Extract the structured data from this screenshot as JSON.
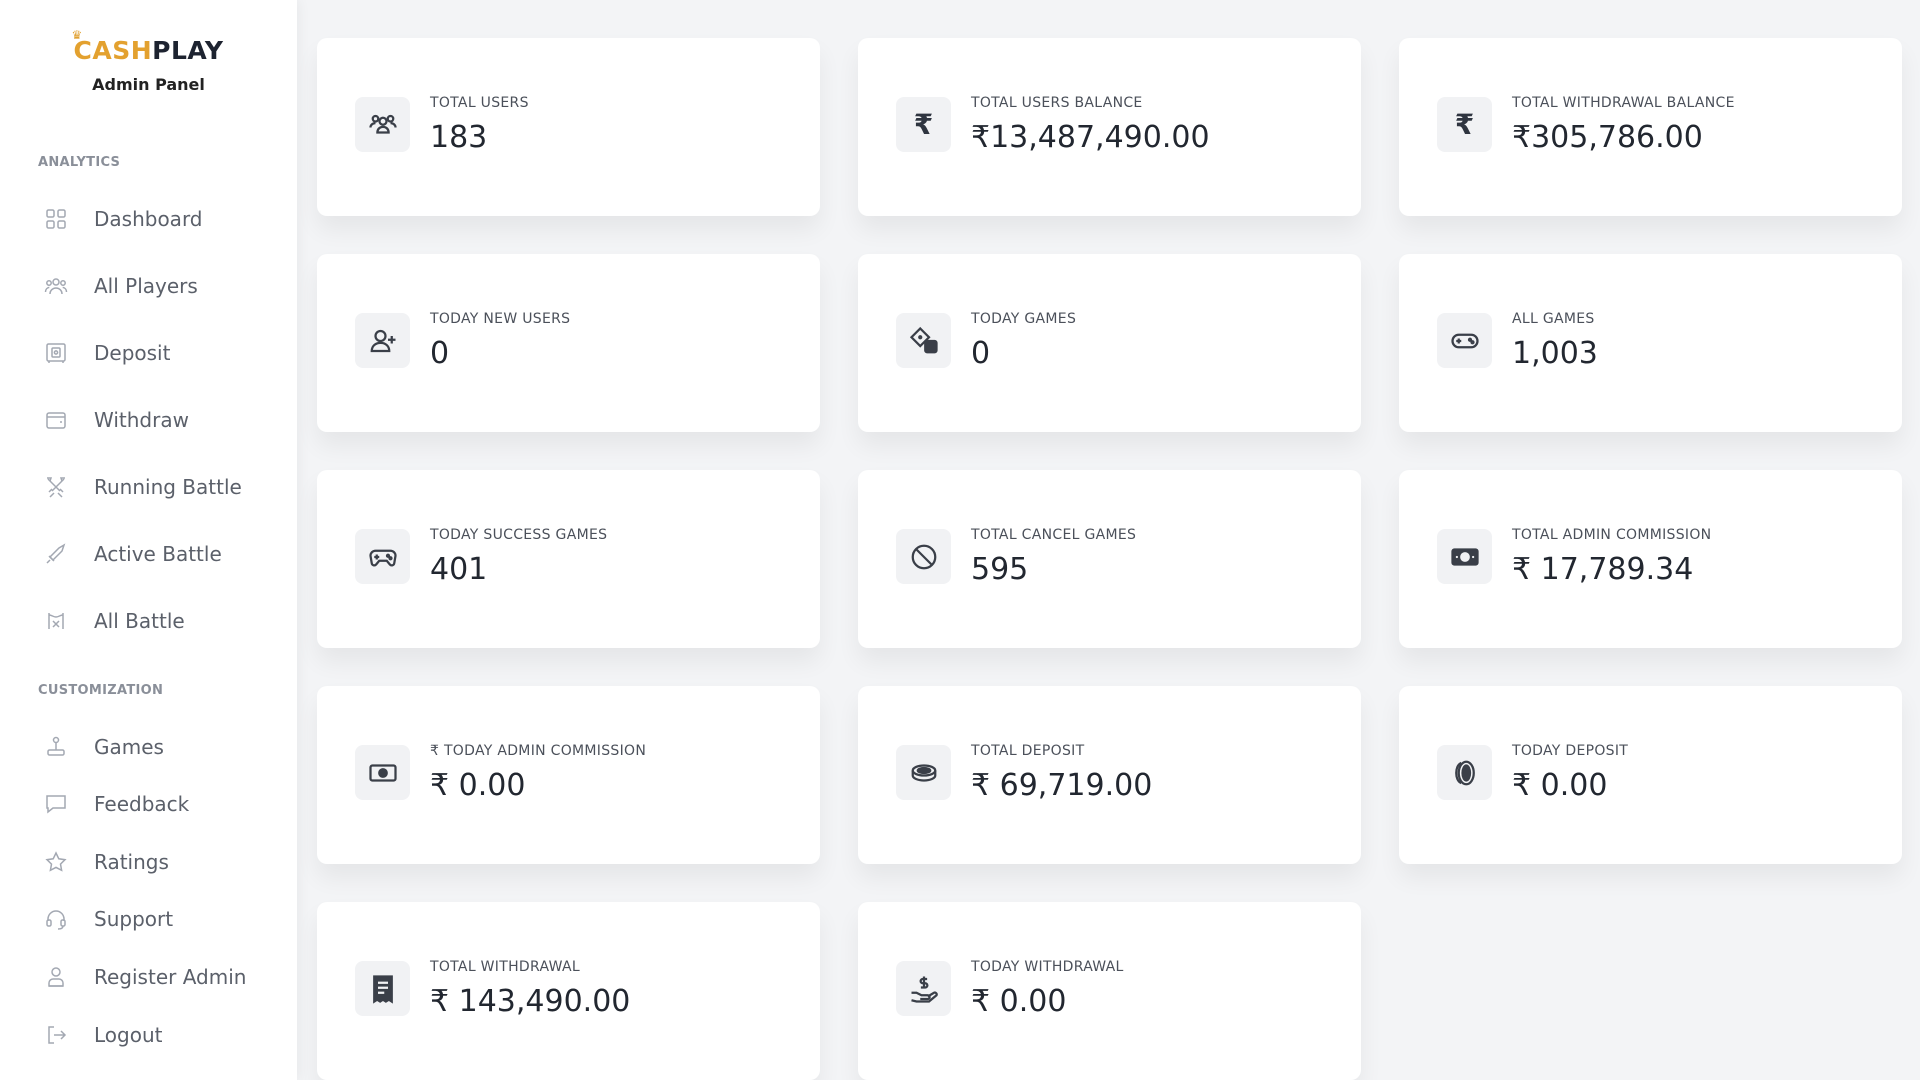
{
  "brand": {
    "cash": "CASH",
    "play": "PLAY",
    "crown": "♛",
    "subtitle": "Admin Panel"
  },
  "sidebar": {
    "sections": [
      {
        "label": "ANALYTICS"
      },
      {
        "label": "CUSTOMIZATION"
      }
    ],
    "items": [
      {
        "label": "Dashboard",
        "icon": "grid-icon"
      },
      {
        "label": "All Players",
        "icon": "users-icon"
      },
      {
        "label": "Deposit",
        "icon": "safe-icon"
      },
      {
        "label": "Withdraw",
        "icon": "wallet-icon"
      },
      {
        "label": "Running Battle",
        "icon": "swords-icon"
      },
      {
        "label": "Active Battle",
        "icon": "sword-icon"
      },
      {
        "label": "All Battle",
        "icon": "battle-icon"
      },
      {
        "label": "Games",
        "icon": "joystick-icon"
      },
      {
        "label": "Feedback",
        "icon": "message-icon"
      },
      {
        "label": "Ratings",
        "icon": "star-icon"
      },
      {
        "label": "Support",
        "icon": "headset-icon"
      },
      {
        "label": "Register Admin",
        "icon": "admin-icon"
      },
      {
        "label": "Logout",
        "icon": "logout-icon"
      }
    ]
  },
  "cards": [
    {
      "label": "TOTAL USERS",
      "value": "183",
      "icon": "users-group-icon"
    },
    {
      "label": "TOTAL USERS BALANCE",
      "value": "₹13,487,490.00",
      "icon": "rupee-icon",
      "glyph": "₹"
    },
    {
      "label": "TOTAL WITHDRAWAL BALANCE",
      "value": "₹305,786.00",
      "icon": "rupee-icon",
      "glyph": "₹"
    },
    {
      "label": "TODAY NEW USERS",
      "value": "0",
      "icon": "user-plus-icon"
    },
    {
      "label": "TODAY GAMES",
      "value": "0",
      "icon": "dice-icon"
    },
    {
      "label": "ALL GAMES",
      "value": "1,003",
      "icon": "gamepad-icon"
    },
    {
      "label": "TODAY SUCCESS GAMES",
      "value": "401",
      "icon": "controller-icon"
    },
    {
      "label": "TOTAL CANCEL GAMES",
      "value": "595",
      "icon": "ban-icon"
    },
    {
      "label": "TOTAL ADMIN COMMISSION",
      "value": "₹ 17,789.34",
      "icon": "cash-icon"
    },
    {
      "label": "₹ TODAY ADMIN COMMISSION",
      "value": "₹ 0.00",
      "icon": "cash-outline-icon"
    },
    {
      "label": "TOTAL DEPOSIT",
      "value": "₹ 69,719.00",
      "icon": "coins-icon"
    },
    {
      "label": "TODAY DEPOSIT",
      "value": "₹ 0.00",
      "icon": "coin-icon"
    },
    {
      "label": "TOTAL WITHDRAWAL",
      "value": "₹ 143,490.00",
      "icon": "receipt-icon"
    },
    {
      "label": "TODAY WITHDRAWAL",
      "value": "₹ 0.00",
      "icon": "hand-dollar-icon"
    }
  ]
}
